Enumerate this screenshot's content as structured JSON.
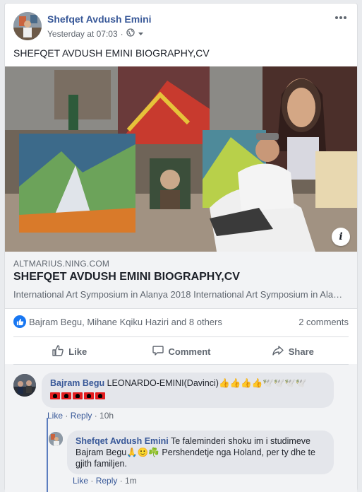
{
  "post": {
    "author": "Shefqet Avdush Emini",
    "timestamp": "Yesterday at 07:03",
    "separator": "·",
    "privacy_icon": "globe-icon",
    "text": "SHEFQET AVDUSH EMINI BIOGRAPHY,CV"
  },
  "link_preview": {
    "domain": "ALTMARIUS.NING.COM",
    "title": "SHEFQET AVDUSH EMINI BIOGRAPHY,CV",
    "description": "International Art Symposium in Alanya 2018 International Art Symposium in Alanya 2018",
    "info_label": "i"
  },
  "reactions": {
    "reactors": "Bajram Begu, Mihane Kqiku Haziri and 8 others",
    "comments_count": "2 comments"
  },
  "actions": {
    "like": "Like",
    "comment": "Comment",
    "share": "Share"
  },
  "comments": [
    {
      "author": "Bajram Begu",
      "text": "LEONARDO-EMINI(Davinci)👍👍👍👍🕊️🕊️🕊️🕊️",
      "like": "Like",
      "reply": "Reply",
      "time": "10h"
    },
    {
      "author": "Shefqet Avdush Emini",
      "text": "Te faleminderi shoku im i studimeve Bajram Begu🙏🙂☘️ Pershendetje nga Holand, per ty dhe te gjith familjen.",
      "like": "Like",
      "reply": "Reply",
      "time": "1m"
    }
  ],
  "colors": {
    "link_blue": "#385898",
    "like_blue": "#1877f2",
    "muted": "#606770"
  }
}
